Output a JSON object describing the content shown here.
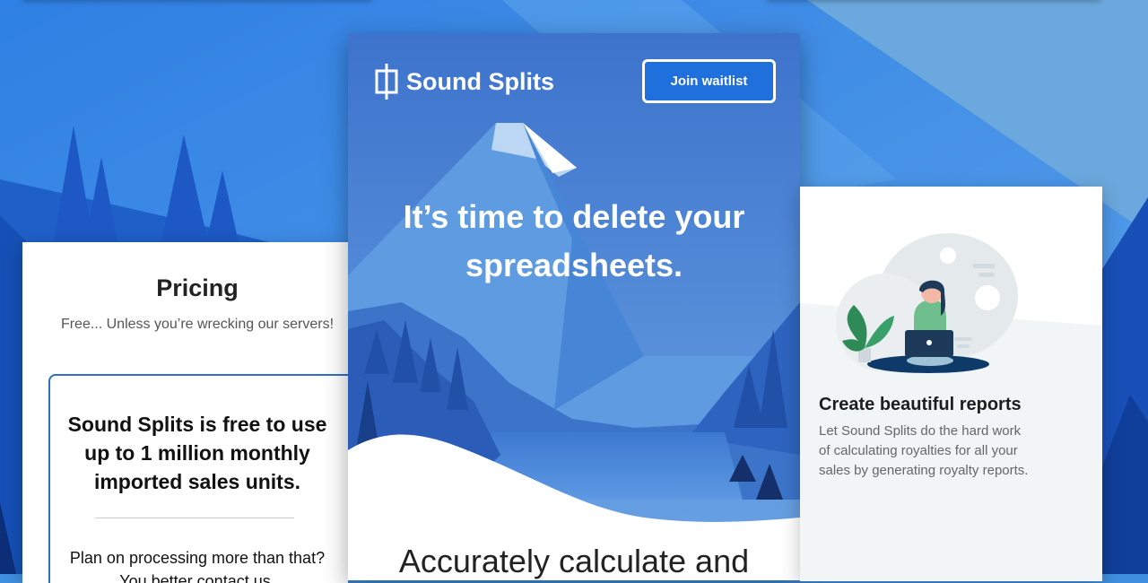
{
  "brand": {
    "name": "Sound Splits",
    "logo_icon": "sound-splits-logo-icon"
  },
  "header": {
    "waitlist_label": "Join waitlist"
  },
  "hero": {
    "headline": "It’s time to delete your spreadsheets.",
    "subheadline": "Accurately calculate and"
  },
  "pricing": {
    "title": "Pricing",
    "subtitle": "Free... Unless you’re wrecking our servers!",
    "plan_headline": "Sound Splits is free to use up to 1 million monthly imported sales units.",
    "plan_more": "Plan on processing more than that? You better contact us."
  },
  "feature": {
    "title": "Create beautiful reports",
    "body": "Let Sound Splits do the hard work of calculating royalties for all your sales by generating royalty reports.",
    "illustration": "woman-with-laptop-illustration"
  },
  "colors": {
    "accent": "#1f6fdc",
    "sky": "#4a86d6",
    "outline": "#2f6fc7"
  }
}
